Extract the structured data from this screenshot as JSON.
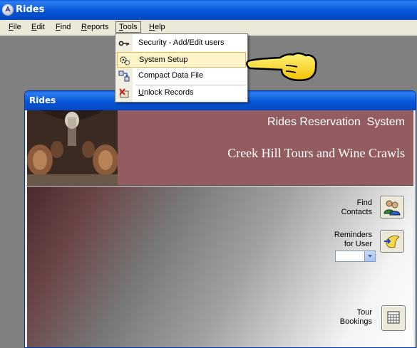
{
  "window": {
    "title": "Rides"
  },
  "menubar": {
    "items": [
      {
        "text": "File",
        "underline": "F",
        "rest": "ile"
      },
      {
        "text": "Edit",
        "underline": "E",
        "rest": "dit"
      },
      {
        "text": "Find",
        "underline": "F",
        "rest": "ind"
      },
      {
        "text": "Reports",
        "underline": "R",
        "rest": "eports"
      },
      {
        "text": "Tools",
        "underline": "T",
        "rest": "ools"
      },
      {
        "text": "Help",
        "underline": "H",
        "rest": "elp"
      }
    ]
  },
  "tools_menu": {
    "items": [
      {
        "label": "Security - Add/Edit users",
        "icon": "key-icon"
      },
      {
        "label": "System Setup",
        "icon": "gears-icon",
        "highlighted": true
      },
      {
        "label": "Compact Data File",
        "icon": "compact-icon"
      },
      {
        "label": "Unlock Records",
        "underline": "U",
        "rest": "nlock Records",
        "icon": "unlock-icon"
      }
    ]
  },
  "child_window": {
    "title": "Rides",
    "banner_title": "Rides Reservation  System",
    "banner_subtitle": "Creek Hill Tours and Wine Crawls",
    "find_contacts": {
      "line1": "Find",
      "line2": "Contacts"
    },
    "reminders": {
      "line1": "Reminders",
      "line2": "for User",
      "selected_value": ""
    },
    "tour_bookings": {
      "line1": "Tour",
      "line2": "Bookings"
    }
  },
  "colors": {
    "banner": "#935c60",
    "titlebar": "#0756d8",
    "highlight": "#fff5c8"
  }
}
